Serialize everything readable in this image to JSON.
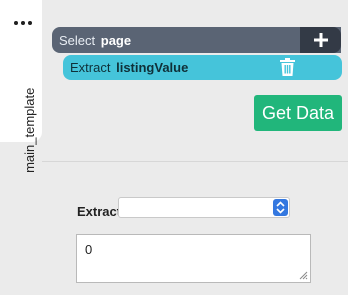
{
  "side_tab": {
    "label": "main_template"
  },
  "select_row": {
    "prefix": "Select",
    "value": "page"
  },
  "extract_row": {
    "prefix": "Extract",
    "value": "listingValue"
  },
  "get_data_button": {
    "label": "Get Data"
  },
  "extract_form": {
    "label": "Extract",
    "selected_value": "",
    "result_text": "0"
  },
  "colors": {
    "select_bar": "#5a6474",
    "plus_box": "#333a46",
    "extract_bar": "#45c4da",
    "get_data": "#21b67b",
    "stepper": "#3478e0"
  },
  "icons": [
    "more-dots-icon",
    "plus-icon",
    "trash-icon",
    "select-stepper-icon",
    "resize-grip-icon"
  ]
}
